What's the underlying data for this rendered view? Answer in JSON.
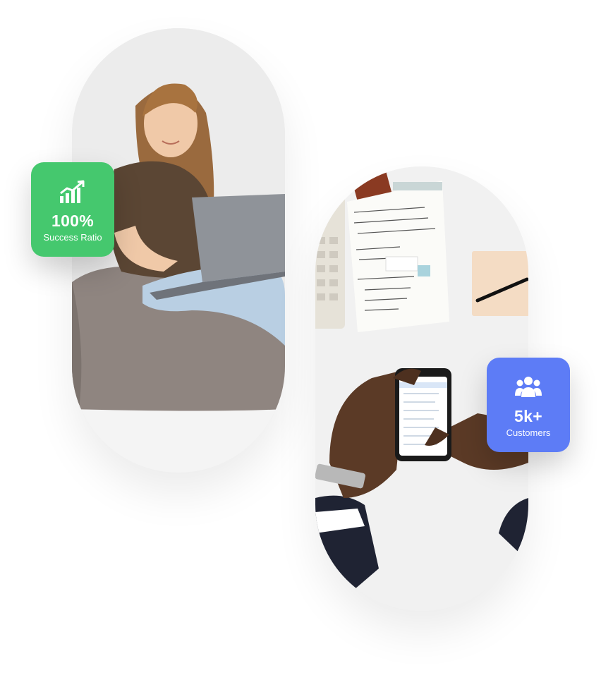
{
  "badges": {
    "success": {
      "value": "100%",
      "label": "Success Ratio",
      "icon": "growth-chart-icon",
      "color": "#45c86e"
    },
    "customers": {
      "value": "5k+",
      "label": "Customers",
      "icon": "users-group-icon",
      "color": "#5d7cf6"
    }
  },
  "images": {
    "left": "woman-with-laptop-photo",
    "right": "desk-phone-hands-photo"
  }
}
